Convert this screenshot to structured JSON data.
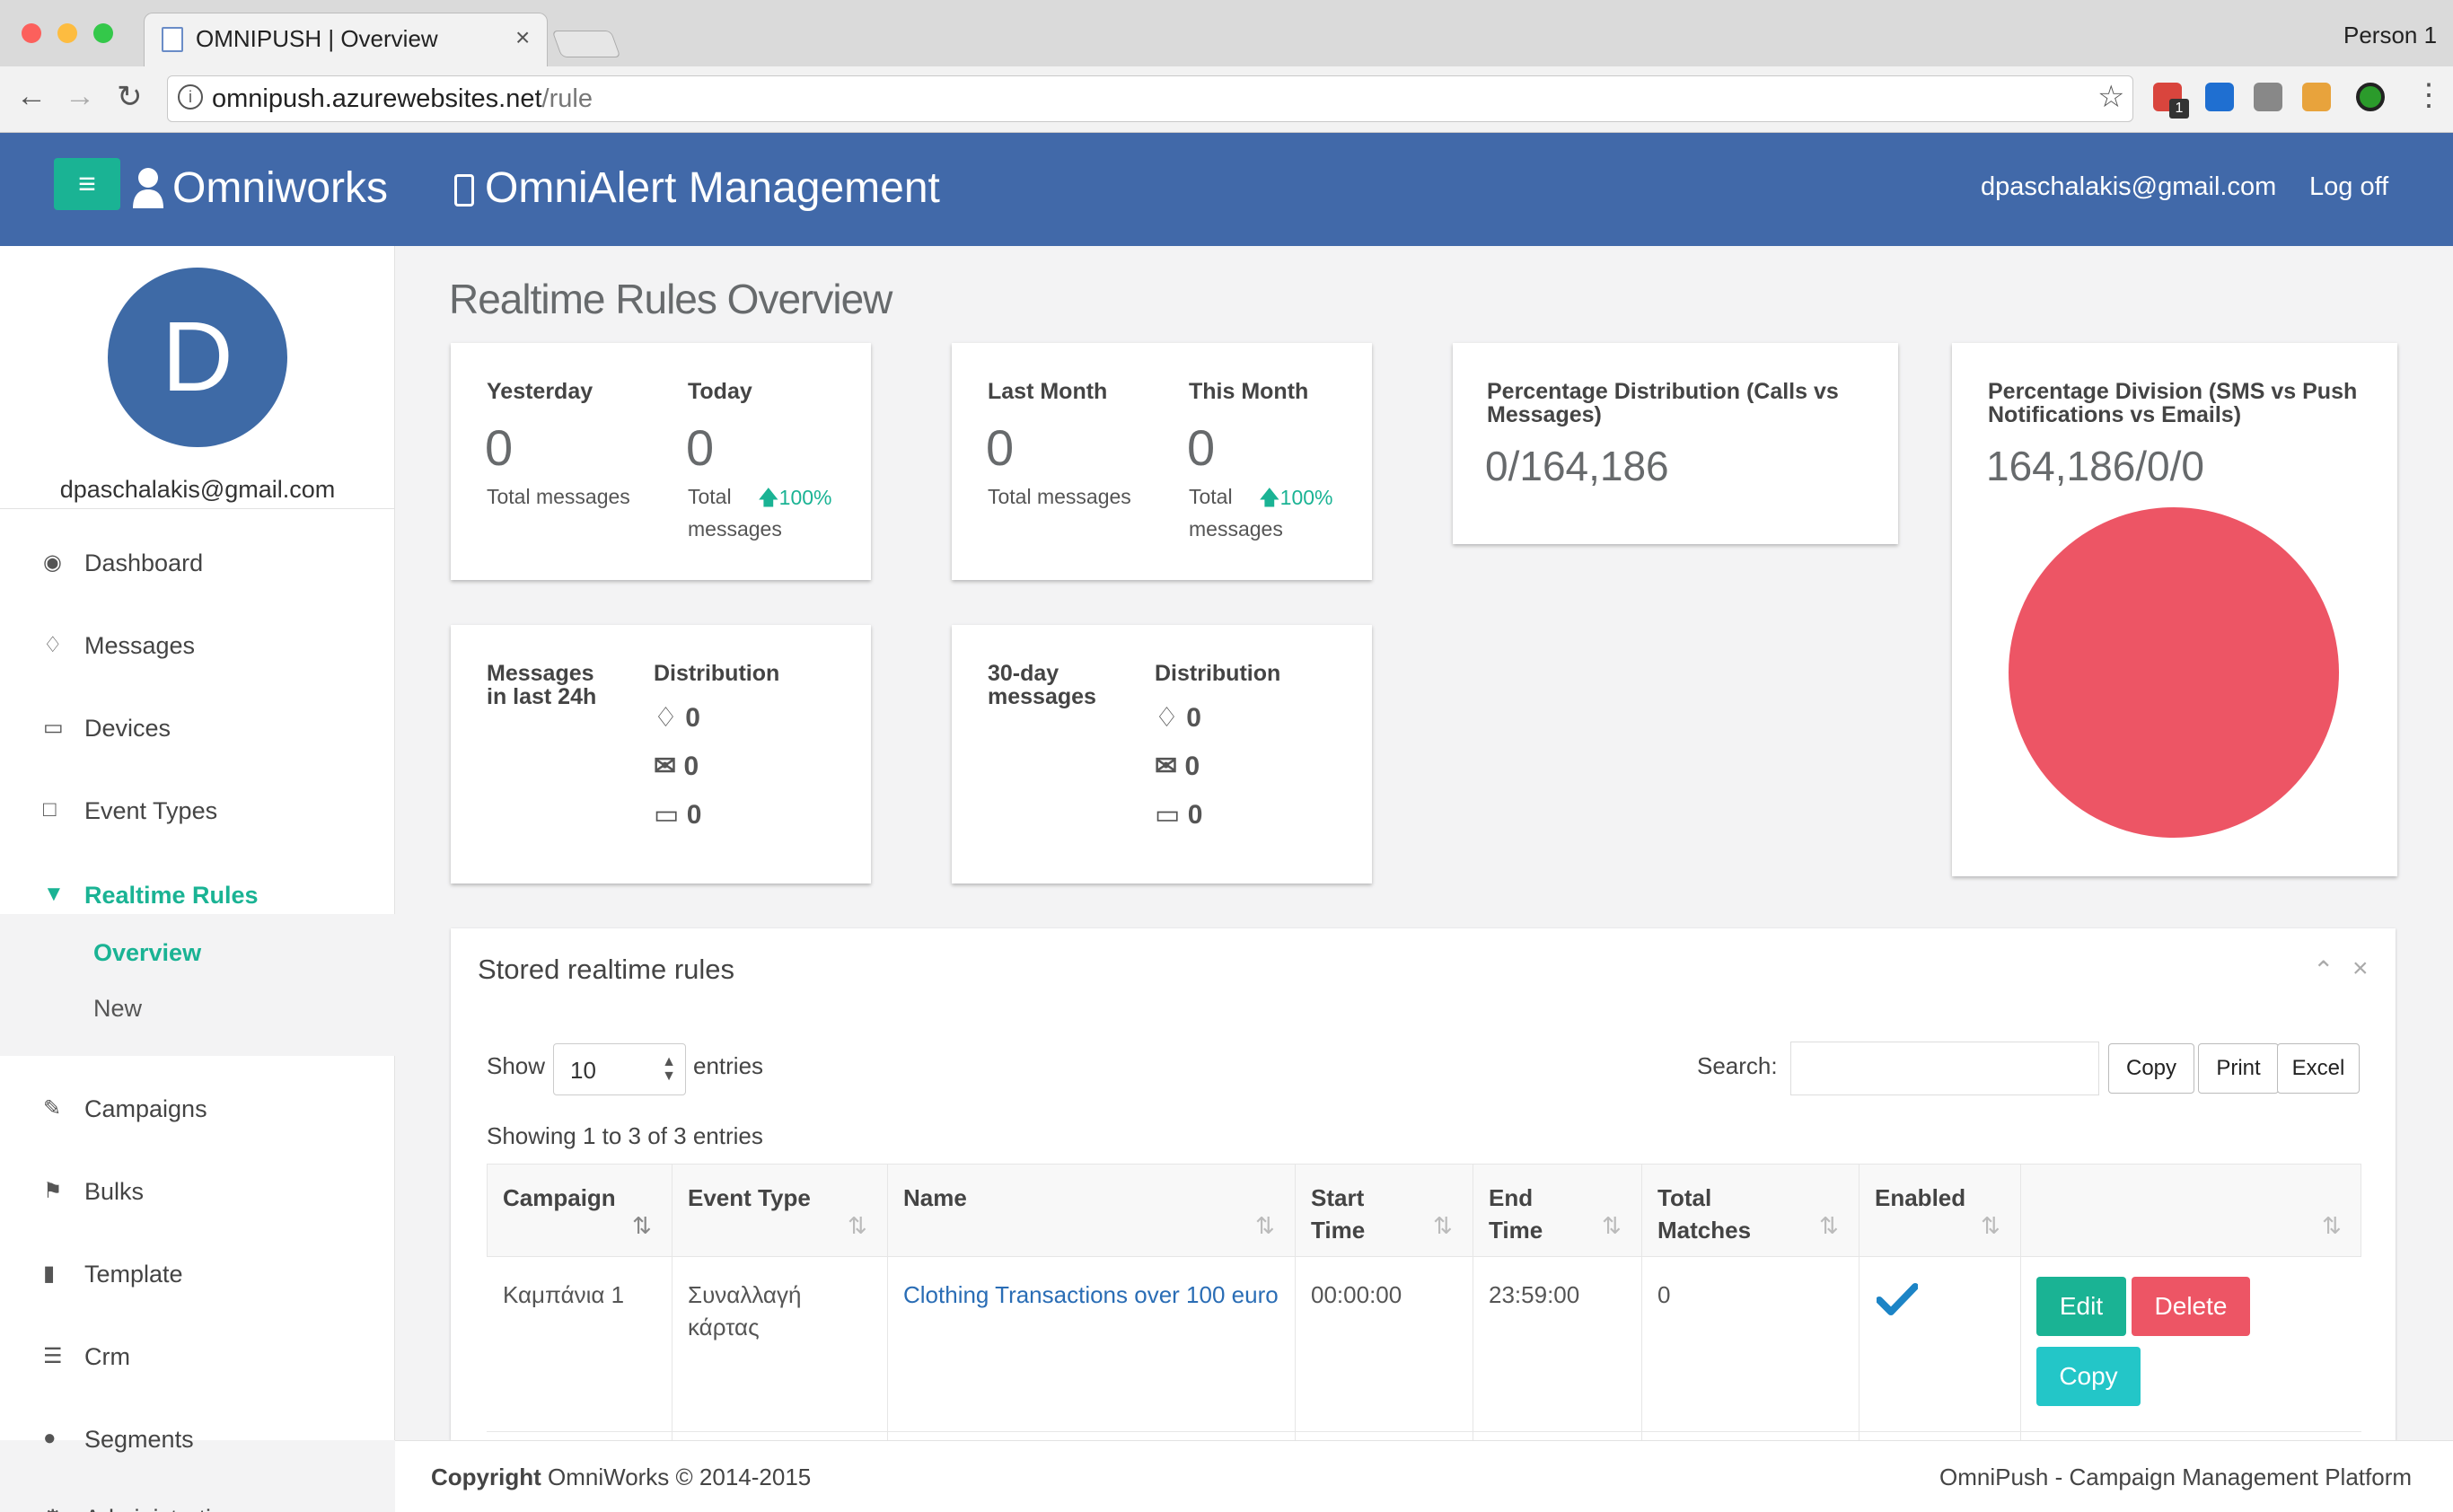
{
  "browser": {
    "tab_title": "OMNIPUSH | Overview",
    "tab_close": "×",
    "profile": "Person 1",
    "url_host": "omnipush.azurewebsites.net",
    "url_path": "/rule",
    "ext_badge": "1"
  },
  "header": {
    "menu_icon": "≡",
    "brand": "Omniworks",
    "app_title": "OmniAlert Management",
    "user_email": "dpaschalakis@gmail.com",
    "logoff": "Log off"
  },
  "sidebar": {
    "avatar_letter": "D",
    "email": "dpaschalakis@gmail.com",
    "items": [
      {
        "label": "Dashboard",
        "icon": "dashboard-icon"
      },
      {
        "label": "Messages",
        "icon": "bell-icon"
      },
      {
        "label": "Devices",
        "icon": "desktop-icon"
      },
      {
        "label": "Event Types",
        "icon": "file-icon"
      },
      {
        "label": "Realtime Rules",
        "icon": "filter-icon"
      },
      {
        "label": "Campaigns",
        "icon": "bullhorn-icon"
      },
      {
        "label": "Bulks",
        "icon": "flag-icon"
      },
      {
        "label": "Template",
        "icon": "bookmark-icon"
      },
      {
        "label": "Crm",
        "icon": "database-icon"
      },
      {
        "label": "Segments",
        "icon": "users-icon"
      },
      {
        "label": "Administration",
        "icon": "cogs-icon"
      }
    ],
    "sub_items": [
      "Overview",
      "New"
    ]
  },
  "main": {
    "page_title": "Realtime Rules Overview",
    "cards": {
      "yesterday_label": "Yesterday",
      "yesterday_value": "0",
      "yesterday_sub": "Total messages",
      "today_label": "Today",
      "today_value": "0",
      "today_sub1": "Total",
      "today_sub2": "messages",
      "today_pct": "100%",
      "lastmonth_label": "Last Month",
      "lastmonth_value": "0",
      "lastmonth_sub": "Total messages",
      "thismonth_label": "This Month",
      "thismonth_value": "0",
      "thismonth_sub1": "Total",
      "thismonth_sub2": "messages",
      "thismonth_pct": "100%",
      "calls_title1": "Percentage Distribution (Calls vs",
      "calls_title2": "Messages)",
      "calls_value": "0/164,186",
      "sms_title1": "Percentage Division (SMS vs Push",
      "sms_title2": "Notifications vs Emails)",
      "sms_value": "164,186/0/0",
      "pie_color": "#ed5565",
      "last24_label1": "Messages",
      "last24_label2": "in last 24h",
      "dist_label": "Distribution",
      "last24_dist": [
        "0",
        "0",
        "0"
      ],
      "day30_label1": "30-day",
      "day30_label2": "messages",
      "day30_dist": [
        "0",
        "0",
        "0"
      ]
    },
    "table": {
      "panel_title": "Stored realtime rules",
      "show_label": "Show",
      "page_size": "10",
      "entries_label": "entries",
      "search_label": "Search:",
      "search_value": "",
      "buttons": [
        "Copy",
        "Print",
        "Excel"
      ],
      "info": "Showing 1 to 3 of 3 entries",
      "columns": [
        [
          "Campaign",
          ""
        ],
        [
          "Event Type",
          ""
        ],
        [
          "Name",
          ""
        ],
        [
          "Start",
          "Time"
        ],
        [
          "End",
          "Time"
        ],
        [
          "Total",
          "Matches"
        ],
        [
          "Enabled",
          ""
        ],
        [
          "",
          ""
        ]
      ],
      "row": {
        "campaign": "Καμπάνια 1",
        "event_type1": "Συναλλαγή",
        "event_type2": "κάρτας",
        "name": "Clothing Transactions over 100 euro",
        "start": "00:00:00",
        "end": "23:59:00",
        "matches": "0",
        "edit": "Edit",
        "delete": "Delete",
        "copy": "Copy"
      }
    }
  },
  "footer": {
    "copyright_bold": "Copyright",
    "copyright_rest": "OmniWorks © 2014-2015",
    "platform": "OmniPush - Campaign Management Platform"
  },
  "colors": {
    "header": "#4169a9",
    "accent": "#1ab394",
    "danger": "#ed5565",
    "info": "#23c6c8"
  }
}
